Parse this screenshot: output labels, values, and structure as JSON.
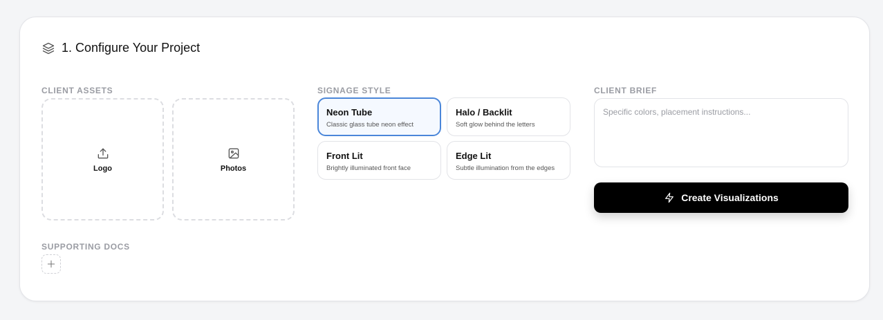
{
  "header": {
    "title": "1. Configure Your Project",
    "icon": "layers-icon"
  },
  "assets": {
    "label": "CLIENT ASSETS",
    "logo": {
      "label": "Logo",
      "icon": "upload-icon"
    },
    "photos": {
      "label": "Photos",
      "icon": "image-icon"
    }
  },
  "docs": {
    "label": "SUPPORTING DOCS",
    "add_icon": "plus-icon"
  },
  "signage": {
    "label": "SIGNAGE STYLE",
    "options": [
      {
        "name": "Neon Tube",
        "desc": "Classic glass tube neon effect",
        "selected": true
      },
      {
        "name": "Halo / Backlit",
        "desc": "Soft glow behind the letters",
        "selected": false
      },
      {
        "name": "Front Lit",
        "desc": "Brightly illuminated front face",
        "selected": false
      },
      {
        "name": "Edge Lit",
        "desc": "Subtle illumination from the edges",
        "selected": false
      }
    ]
  },
  "brief": {
    "label": "CLIENT BRIEF",
    "placeholder": "Specific colors, placement instructions...",
    "value": ""
  },
  "create": {
    "label": "Create Visualizations",
    "icon": "lightning-icon"
  },
  "colors": {
    "accent": "#4a86d9",
    "button": "#000000",
    "muted": "#9a9ca3"
  }
}
